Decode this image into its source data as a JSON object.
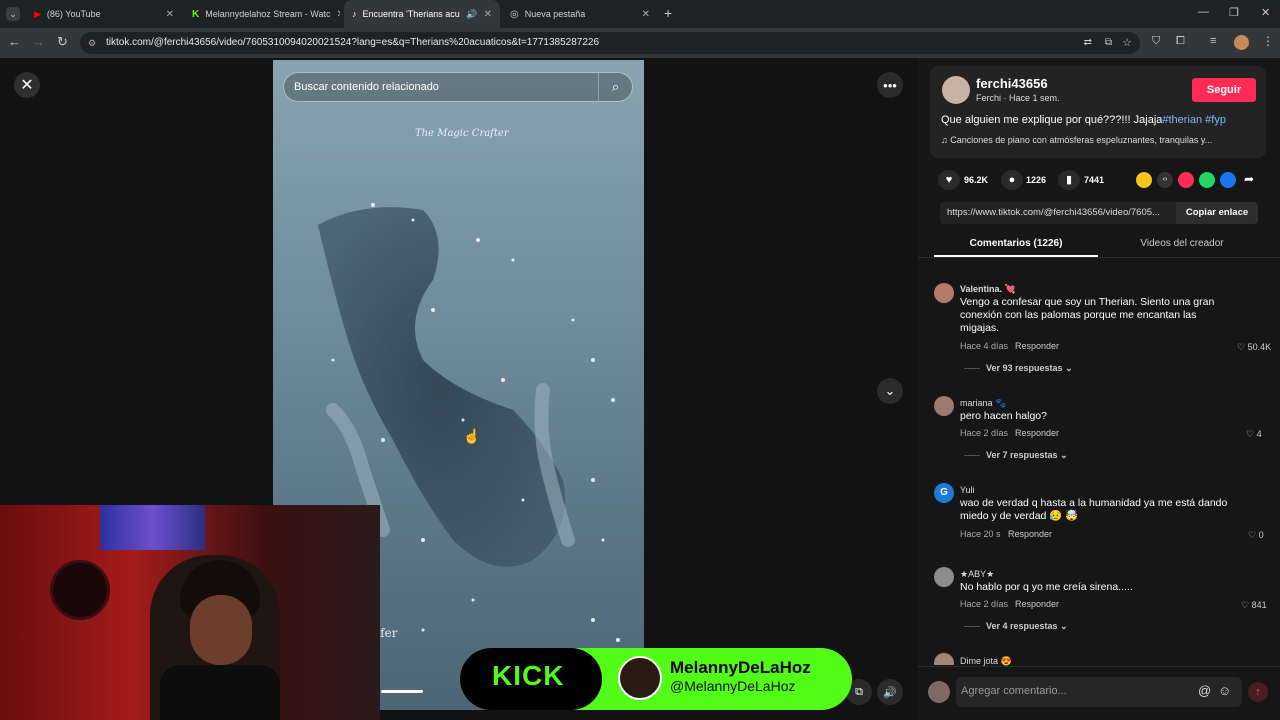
{
  "browser": {
    "tabs": [
      {
        "label": "(86) YouTube"
      },
      {
        "label": "Melannydelahoz Stream - Watc"
      },
      {
        "label": "Encuentra 'Therians acuatic"
      },
      {
        "label": "Nueva pestaña"
      }
    ],
    "url": "tiktok.com/@ferchi43656/video/7605310094020021524?lang=es&q=Therians%20acuaticos&t=1771385287226"
  },
  "video": {
    "search_placeholder": "Buscar contenido relacionado",
    "watermark": "The Magic Crafter",
    "watermark_bottom": "afer"
  },
  "author": {
    "username": "ferchi43656",
    "meta": "Ferchi · Hace 1 sem.",
    "follow_label": "Seguir",
    "caption_text": "Que alguien me explique por qué???!!! Jajaja",
    "hashtags": "#therian #fyp",
    "music": "Canciones de piano con atmósferas espeluznantes, tranquilas y..."
  },
  "stats": {
    "likes": "96.2K",
    "comments": "1226",
    "saves": "7441"
  },
  "share": {
    "link": "https://www.tiktok.com/@ferchi43656/video/7605...",
    "copy_label": "Copiar enlace"
  },
  "tabs": {
    "comments": "Comentarios (1226)",
    "creator": "Videos del creador"
  },
  "comments": [
    {
      "name": "Valentina. 💘",
      "text1": "Vengo a confesar que soy un Therian. Siento una gran",
      "text2": "conexión con las palomas porque me encantan las",
      "text3": "migajas.",
      "time": "Hace 4 días",
      "reply": "Responder",
      "likes": "50.4K",
      "replies": "Ver 93 respuestas"
    },
    {
      "name": "mariana 🐾",
      "text1": "pero hacen halgo?",
      "time": "Hace 2 días",
      "reply": "Responder",
      "likes": "4",
      "replies": "Ver 7 respuestas"
    },
    {
      "name": "Yuli",
      "initial": "G",
      "text1": "wao de verdad q hasta a la humanidad ya me está dando",
      "text2": "miedo y de verdad 😥 🤯",
      "time": "Hace 20 s",
      "reply": "Responder",
      "likes": "0"
    },
    {
      "name": "★ABY★",
      "text1": "No hablo por q yo me creía sirena.....",
      "time": "Hace 2 días",
      "reply": "Responder",
      "likes": "841",
      "replies": "Ver 4 respuestas"
    },
    {
      "name": "Dime jota 😍"
    }
  ],
  "comment_input_placeholder": "Agregar comentario...",
  "kick": {
    "logo": "KICK",
    "name": "MelannyDeLaHoz",
    "handle": "@MelannyDeLaHoz"
  },
  "colors": {
    "follow": "#fe2c55",
    "kick_green": "#53fc18",
    "hashtag": "#7eb6ff"
  }
}
